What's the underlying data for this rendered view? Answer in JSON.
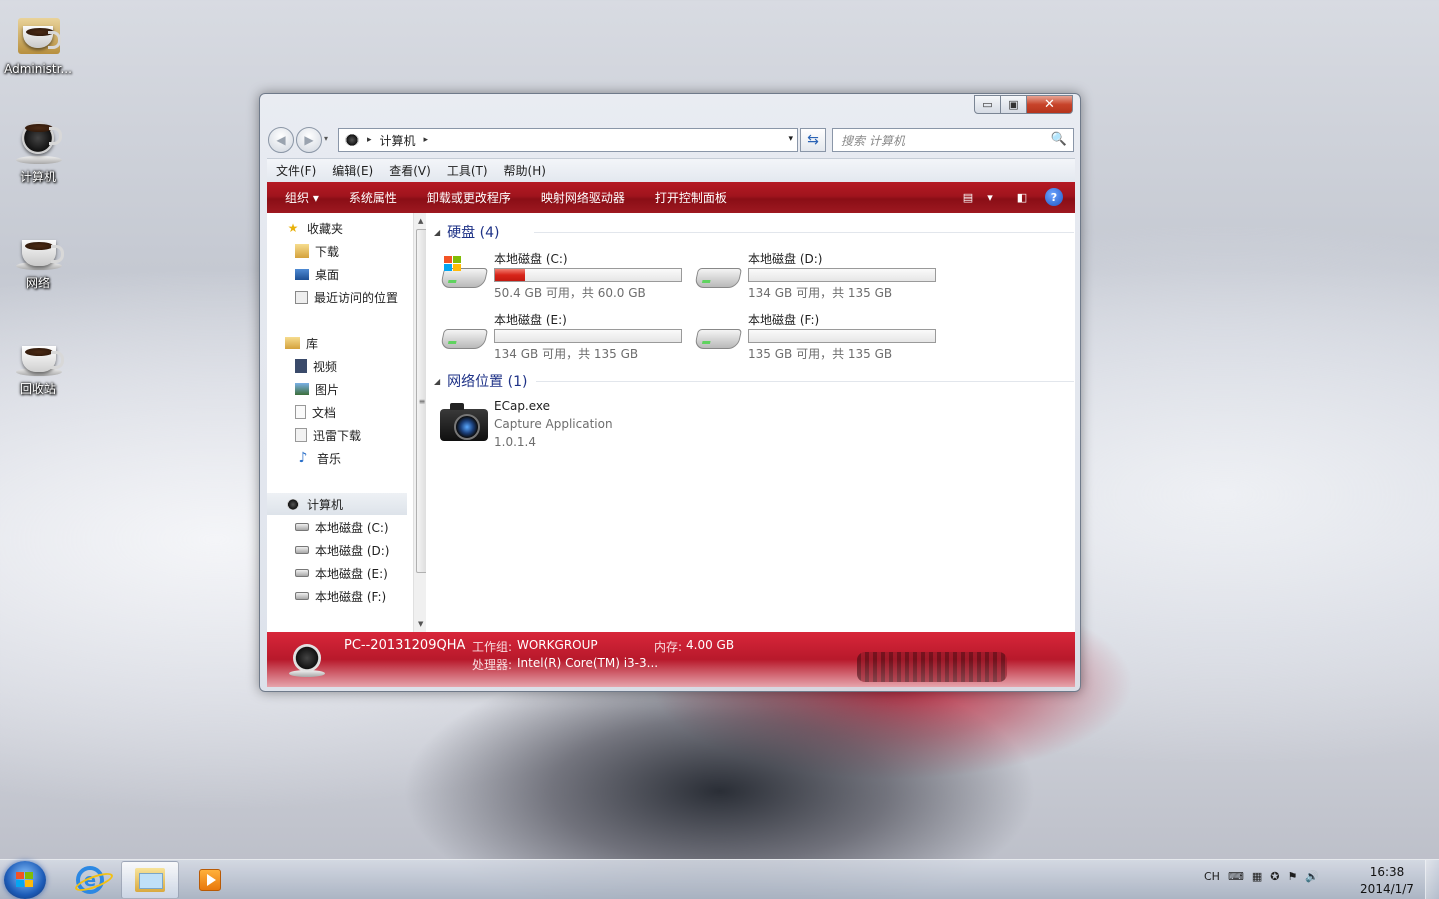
{
  "desktop": {
    "icons": [
      {
        "label": "Administr...",
        "icon": "user-folder-icon"
      },
      {
        "label": "计算机",
        "icon": "computer-icon"
      },
      {
        "label": "网络",
        "icon": "network-icon"
      },
      {
        "label": "回收站",
        "icon": "recycle-bin-icon"
      }
    ]
  },
  "window": {
    "controls": {
      "minimize": "▭",
      "maximize": "▣",
      "close": "✕"
    },
    "nav": {
      "back": "◀",
      "forward": "▶",
      "dropdown": "▾"
    },
    "address": {
      "crumb": "计算机",
      "sep": "▸",
      "dropdown": "▾"
    },
    "refresh": "⇆",
    "search": {
      "placeholder": "搜索 计算机",
      "icon": "🔍"
    },
    "menu": [
      "文件(F)",
      "编辑(E)",
      "查看(V)",
      "工具(T)",
      "帮助(H)"
    ],
    "commands": [
      "组织 ▾",
      "系统属性",
      "卸载或更改程序",
      "映射网络驱动器",
      "打开控制面板"
    ],
    "view_icons": {
      "view": "▤",
      "view_dd": "▾",
      "preview": "◧",
      "help": "?"
    },
    "nav_pane": {
      "favorites": {
        "label": "收藏夹",
        "items": [
          "下载",
          "桌面",
          "最近访问的位置"
        ]
      },
      "libraries": {
        "label": "库",
        "items": [
          "视频",
          "图片",
          "文档",
          "迅雷下载",
          "音乐"
        ]
      },
      "computer": {
        "label": "计算机",
        "items": [
          "本地磁盘 (C:)",
          "本地磁盘 (D:)",
          "本地磁盘 (E:)",
          "本地磁盘 (F:)"
        ]
      }
    },
    "content": {
      "hard_disks": {
        "title": "硬盘 (4)",
        "drives": [
          {
            "name": "本地磁盘 (C:)",
            "usage": "50.4 GB 可用，共 60.0 GB",
            "used_fraction": 0.16,
            "system": true
          },
          {
            "name": "本地磁盘 (D:)",
            "usage": "134 GB 可用，共 135 GB",
            "used_fraction": 0.0
          },
          {
            "name": "本地磁盘 (E:)",
            "usage": "134 GB 可用，共 135 GB",
            "used_fraction": 0.0
          },
          {
            "name": "本地磁盘 (F:)",
            "usage": "135 GB 可用，共 135 GB",
            "used_fraction": 0.0
          }
        ]
      },
      "network": {
        "title": "网络位置 (1)",
        "app": {
          "name": "ECap.exe",
          "desc": "Capture Application",
          "version": "1.0.1.4"
        }
      }
    },
    "details": {
      "pc_name": "PC--20131209QHA",
      "workgroup_label": "工作组:",
      "workgroup": "WORKGROUP",
      "memory_label": "内存:",
      "memory": "4.00 GB",
      "cpu_label": "处理器:",
      "cpu": "Intel(R) Core(TM) i3-3..."
    }
  },
  "taskbar": {
    "tray_lang": "CH",
    "tray_icons": [
      "keyboard-icon",
      "network-status-icon",
      "security-icon",
      "action-center-icon",
      "volume-icon"
    ],
    "tray_glyphs": [
      "⌨",
      "▦",
      "✪",
      "⚑",
      "🔊"
    ],
    "time": "16:38",
    "date": "2014/1/7"
  },
  "colors": {
    "accent_red": "#a0141d",
    "link_blue": "#1e3287",
    "drive_bar_red": "#d8251a"
  }
}
